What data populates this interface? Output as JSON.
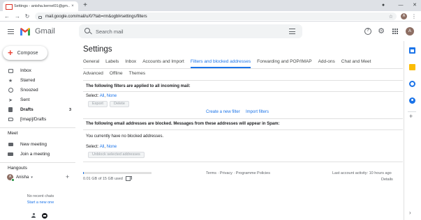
{
  "browser": {
    "tab_title": "Settings - anisha.kernel01@gm...",
    "tab_close": "×",
    "new_tab": "+",
    "url": "mail.google.com/mail/u/0/?tab=rm&ogbl#settings/filters",
    "profile_initial": "A"
  },
  "header": {
    "app_name": "Gmail",
    "search_placeholder": "Search mail",
    "help_glyph": "?",
    "profile_initial": "A"
  },
  "sidebar": {
    "compose_label": "Compose",
    "items": [
      {
        "label": "Inbox",
        "count": ""
      },
      {
        "label": "Starred",
        "count": ""
      },
      {
        "label": "Snoozed",
        "count": ""
      },
      {
        "label": "Sent",
        "count": ""
      },
      {
        "label": "Drafts",
        "count": "3"
      },
      {
        "label": "[Imap]/Drafts",
        "count": ""
      }
    ],
    "meet_title": "Meet",
    "meet_items": [
      "New meeting",
      "Join a meeting"
    ],
    "hangouts_title": "Hangouts",
    "hangouts_user": "Anisha",
    "hangouts_user_initial": "A",
    "no_chats": "No recent chats",
    "start_new": "Start a new one"
  },
  "settings": {
    "title": "Settings",
    "tabs_row1": [
      {
        "label": "General",
        "active": false
      },
      {
        "label": "Labels",
        "active": false
      },
      {
        "label": "Inbox",
        "active": false
      },
      {
        "label": "Accounts and Import",
        "active": false
      },
      {
        "label": "Filters and blocked addresses",
        "active": true
      },
      {
        "label": "Forwarding and POP/IMAP",
        "active": false
      },
      {
        "label": "Add-ons",
        "active": false
      },
      {
        "label": "Chat and Meet",
        "active": false
      }
    ],
    "tabs_row2": [
      {
        "label": "Advanced",
        "active": false
      },
      {
        "label": "Offline",
        "active": false
      },
      {
        "label": "Themes",
        "active": false
      }
    ],
    "filters_heading": "The following filters are applied to all incoming mail:",
    "select_label": "Select:",
    "select_all": "All",
    "select_none": "None",
    "export_btn": "Export",
    "delete_btn": "Delete",
    "create_filter": "Create a new filter",
    "import_filters": "Import filters",
    "blocked_heading": "The following email addresses are blocked. Messages from these addresses will appear in Spam:",
    "no_blocked": "You currently have no blocked addresses.",
    "unblock_btn": "Unblock selected addresses"
  },
  "footer": {
    "storage_used_fraction": 0.0007,
    "storage_text": "0.01 GB of 15 GB used",
    "links": "Terms · Privacy · Programme Policies",
    "last_activity": "Last account activity: 10 hours ago",
    "details": "Details"
  },
  "colors": {
    "accent": "#1a73e8",
    "gmail_red": "#ea4335"
  }
}
